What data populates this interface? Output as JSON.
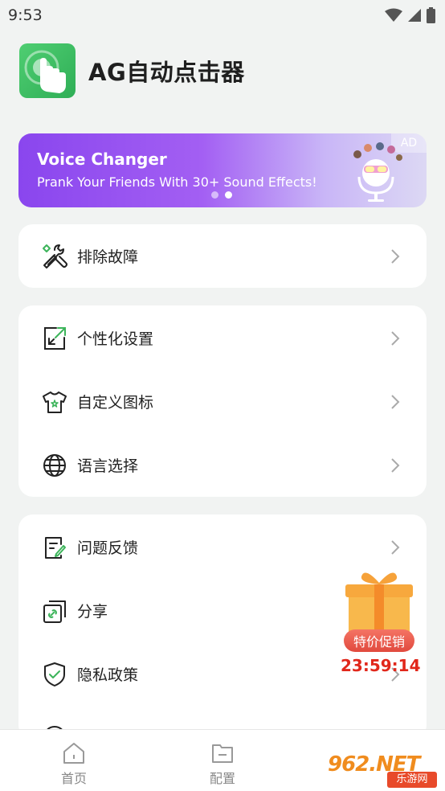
{
  "status_bar": {
    "time": "9:53"
  },
  "app": {
    "title": "AG自动点击器"
  },
  "ad": {
    "title": "Voice Changer",
    "subtitle": "Prank Your Friends With 30+ Sound Effects!",
    "badge": "AD"
  },
  "menu": {
    "group1": [
      {
        "label": "排除故障",
        "icon": "wrench-screwdriver-icon"
      }
    ],
    "group2": [
      {
        "label": "个性化设置",
        "icon": "expand-square-icon"
      },
      {
        "label": "自定义图标",
        "icon": "tshirt-icon"
      },
      {
        "label": "语言选择",
        "icon": "globe-icon"
      }
    ],
    "group3": [
      {
        "label": "问题反馈",
        "icon": "feedback-doc-icon"
      },
      {
        "label": "分享",
        "icon": "share-link-icon"
      },
      {
        "label": "隐私政策",
        "icon": "shield-check-icon"
      }
    ]
  },
  "promo": {
    "tag": "特价促销",
    "timer": "23:59:14"
  },
  "bottom_nav": [
    {
      "label": "首页",
      "icon": "home-icon"
    },
    {
      "label": "配置",
      "icon": "folder-icon"
    }
  ],
  "watermark": {
    "text": "962.NET",
    "sub": "乐游网"
  },
  "colors": {
    "accent": "#2fae56",
    "background": "#f1f3f2",
    "ad_purple": "#8a46ee",
    "promo_red": "#e1271b"
  }
}
